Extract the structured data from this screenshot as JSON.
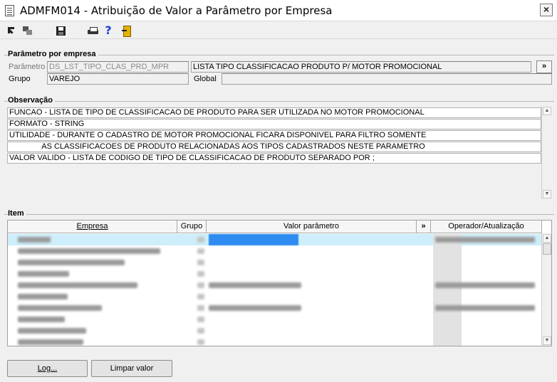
{
  "window": {
    "title": "ADMFM014 - Atribuição de Valor a Parâmetro por Empresa",
    "close_glyph": "×"
  },
  "toolbar": {
    "icons": [
      "select-arrow-icon",
      "windows-icon",
      "save-icon",
      "print-icon",
      "help-icon",
      "exit-door-icon"
    ],
    "help_glyph": "?"
  },
  "parametro_section": {
    "legend": "Parâmetro por empresa",
    "parametro_label": "Parâmetro",
    "parametro_value": "DS_LST_TIPO_CLAS_PRD_MPR",
    "descricao_value": "LISTA TIPO CLASSIFICACAO PRODUTO P/  MOTOR PROMOCIONAL",
    "more_button": "»",
    "grupo_label": "Grupo",
    "grupo_value": "VAREJO",
    "global_label": "Global",
    "global_value": ""
  },
  "observacao_section": {
    "legend": "Observação",
    "lines": [
      "FUNCAO - LISTA DE TIPO DE CLASSIFICACAO DE PRODUTO PARA SER UTILIZADA NO MOTOR PROMOCIONAL",
      "FORMATO - STRING",
      "UTILIDADE -  DURANTE O CADASTRO DE MOTOR PROMOCIONAL FICARA DISPONIVEL PARA FILTRO SOMENTE",
      "               AS CLASSIFICACOES DE PRODUTO RELACIONADAS AOS TIPOS CADASTRADOS NESTE PARAMETRO",
      "VALOR VALIDO - LISTA DE CODIGO DE TIPO DE CLASSIFICACAO DE PRODUTO SEPARADO POR ;"
    ]
  },
  "item_section": {
    "legend": "Item",
    "columns": {
      "empresa": "Empresa",
      "grupo": "Grupo",
      "valor": "Valor parâmetro",
      "more": "»",
      "operador": "Operador/Atualização"
    },
    "row_count": 10
  },
  "buttons": {
    "log": "Log...",
    "limpar": "Limpar valor"
  },
  "colors": {
    "selected_row": "#cdeefa",
    "selected_value": "#2f8cf0",
    "blurred_text": "#9a9a9a"
  }
}
